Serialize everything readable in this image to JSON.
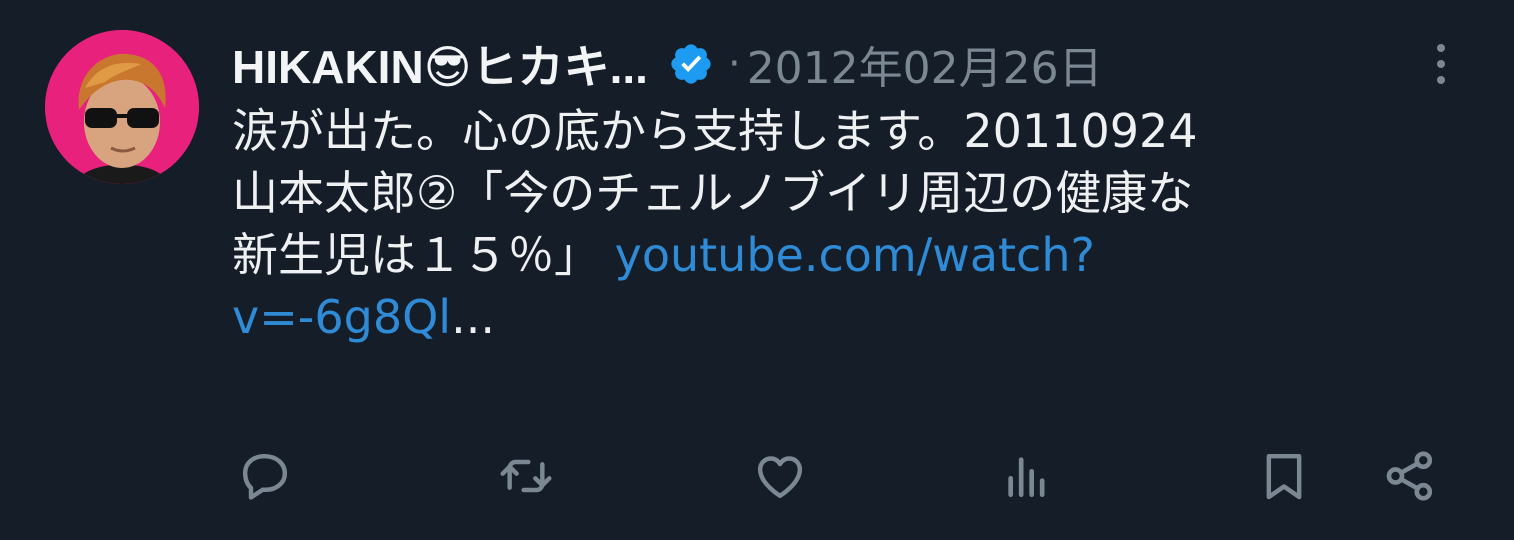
{
  "author": {
    "display_name": "HIKAKIN😎ヒカキ...",
    "verified": true,
    "avatar": "avatar-photo"
  },
  "meta": {
    "separator": "·",
    "date": "2012年02月26日",
    "more_icon": "more-vertical-icon"
  },
  "tweet": {
    "line1": "涙が出た。心の底から支持します。20110924",
    "line2": "山本太郎②「今のチェルノブイリ周辺の健康な",
    "line3_text": "新生児は１５％」 ",
    "link_part1": "youtube.com/watch?",
    "link_part2": "v=-6g8Ql",
    "ellipsis": "..."
  },
  "actions": [
    {
      "name": "reply",
      "icon": "reply-icon"
    },
    {
      "name": "retweet",
      "icon": "retweet-icon"
    },
    {
      "name": "like",
      "icon": "heart-icon"
    },
    {
      "name": "views",
      "icon": "analytics-icon"
    },
    {
      "name": "bookmark",
      "icon": "bookmark-icon"
    },
    {
      "name": "share",
      "icon": "share-icon"
    }
  ],
  "colors": {
    "background": "#151d28",
    "text": "#e7e9ea",
    "muted": "#7b8793",
    "link": "#2f8bd5",
    "verified": "#1d9bf0",
    "avatar_bg": "#e8217c"
  }
}
